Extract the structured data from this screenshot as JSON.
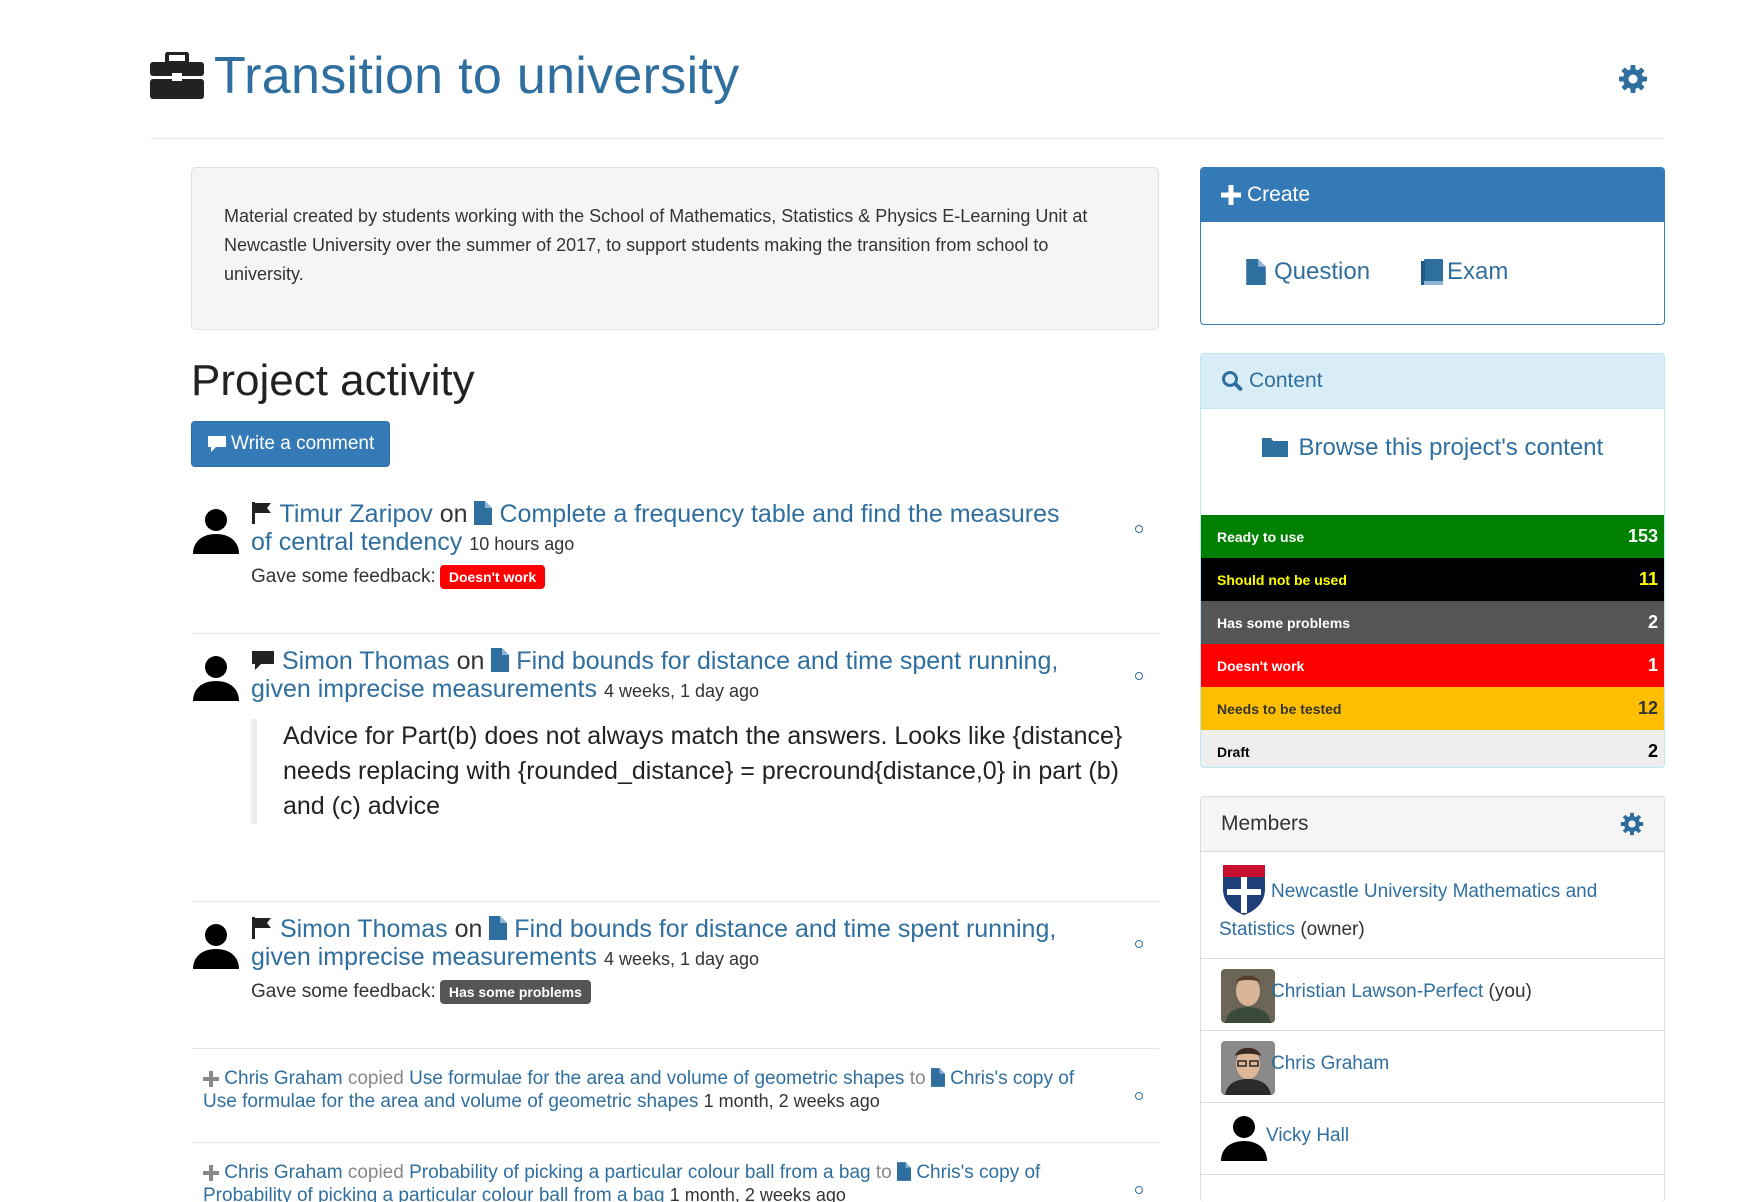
{
  "header": {
    "title": "Transition to university"
  },
  "description": "Material created by students working with the School of Mathematics, Statistics & Physics E-Learning Unit at Newcastle University over the summer of 2017, to support students making the transition from school to university.",
  "activity": {
    "title": "Project activity",
    "comment_button": "Write a comment",
    "items": [
      {
        "user": "Timur Zaripov",
        "on": "on",
        "item": "Complete a frequency table and find the measures of central tendency",
        "time": "10 hours ago",
        "feedback_prefix": "Gave some feedback:",
        "feedback_label": "Doesn't work"
      },
      {
        "user": "Simon Thomas",
        "on": "on",
        "item": "Find bounds for distance and time spent running, given imprecise measurements",
        "time": "4 weeks, 1 day ago",
        "comment": "Advice for Part(b) does not always match the answers. Looks like {distance} needs replacing with {rounded_distance} = precround{distance,0} in part (b) and (c) advice"
      },
      {
        "user": "Simon Thomas",
        "on": "on",
        "item": "Find bounds for distance and time spent running, given imprecise measurements",
        "time": "4 weeks, 1 day ago",
        "feedback_prefix": "Gave some feedback:",
        "feedback_label": "Has some problems"
      },
      {
        "user": "Chris Graham",
        "verb": "copied",
        "source": "Use formulae for the area and volume of geometric shapes",
        "to": "to",
        "target": "Chris's copy of Use formulae for the area and volume of geometric shapes",
        "time": "1 month, 2 weeks ago"
      },
      {
        "user": "Chris Graham",
        "verb": "copied",
        "source": "Probability of picking a particular colour ball from a bag",
        "to": "to",
        "target": "Chris's copy of Probability of picking a particular colour ball from a bag",
        "time": "1 month, 2 weeks ago"
      }
    ]
  },
  "create": {
    "title": "Create",
    "question": "Question",
    "exam": "Exam"
  },
  "content": {
    "title": "Content",
    "browse": "Browse this project's content",
    "statuses": [
      {
        "label": "Ready to use",
        "count": "153",
        "bg": "#008000",
        "fg": "#ffffff"
      },
      {
        "label": "Should not be used",
        "count": "11",
        "bg": "#000000",
        "fg": "#ffff00"
      },
      {
        "label": "Has some problems",
        "count": "2",
        "bg": "#555555",
        "fg": "#ffffff"
      },
      {
        "label": "Doesn't work",
        "count": "1",
        "bg": "#ff0000",
        "fg": "#ffffff"
      },
      {
        "label": "Needs to be tested",
        "count": "12",
        "bg": "#ffbf00",
        "fg": "#333333"
      },
      {
        "label": "Draft",
        "count": "2",
        "bg": "#eeeeee",
        "fg": "#000000"
      }
    ]
  },
  "members": {
    "title": "Members",
    "list": [
      {
        "name": "Newcastle University Mathematics and Statistics",
        "role": "(owner)"
      },
      {
        "name": "Christian Lawson-Perfect",
        "role": "(you)"
      },
      {
        "name": "Chris Graham",
        "role": ""
      },
      {
        "name": "Vicky Hall",
        "role": ""
      }
    ]
  },
  "colors": {
    "link": "#2f6f9f",
    "primary": "#337ab7",
    "info_bg": "#d9edf7",
    "doesnt_work": "#ff0000",
    "has_problems": "#555555"
  }
}
